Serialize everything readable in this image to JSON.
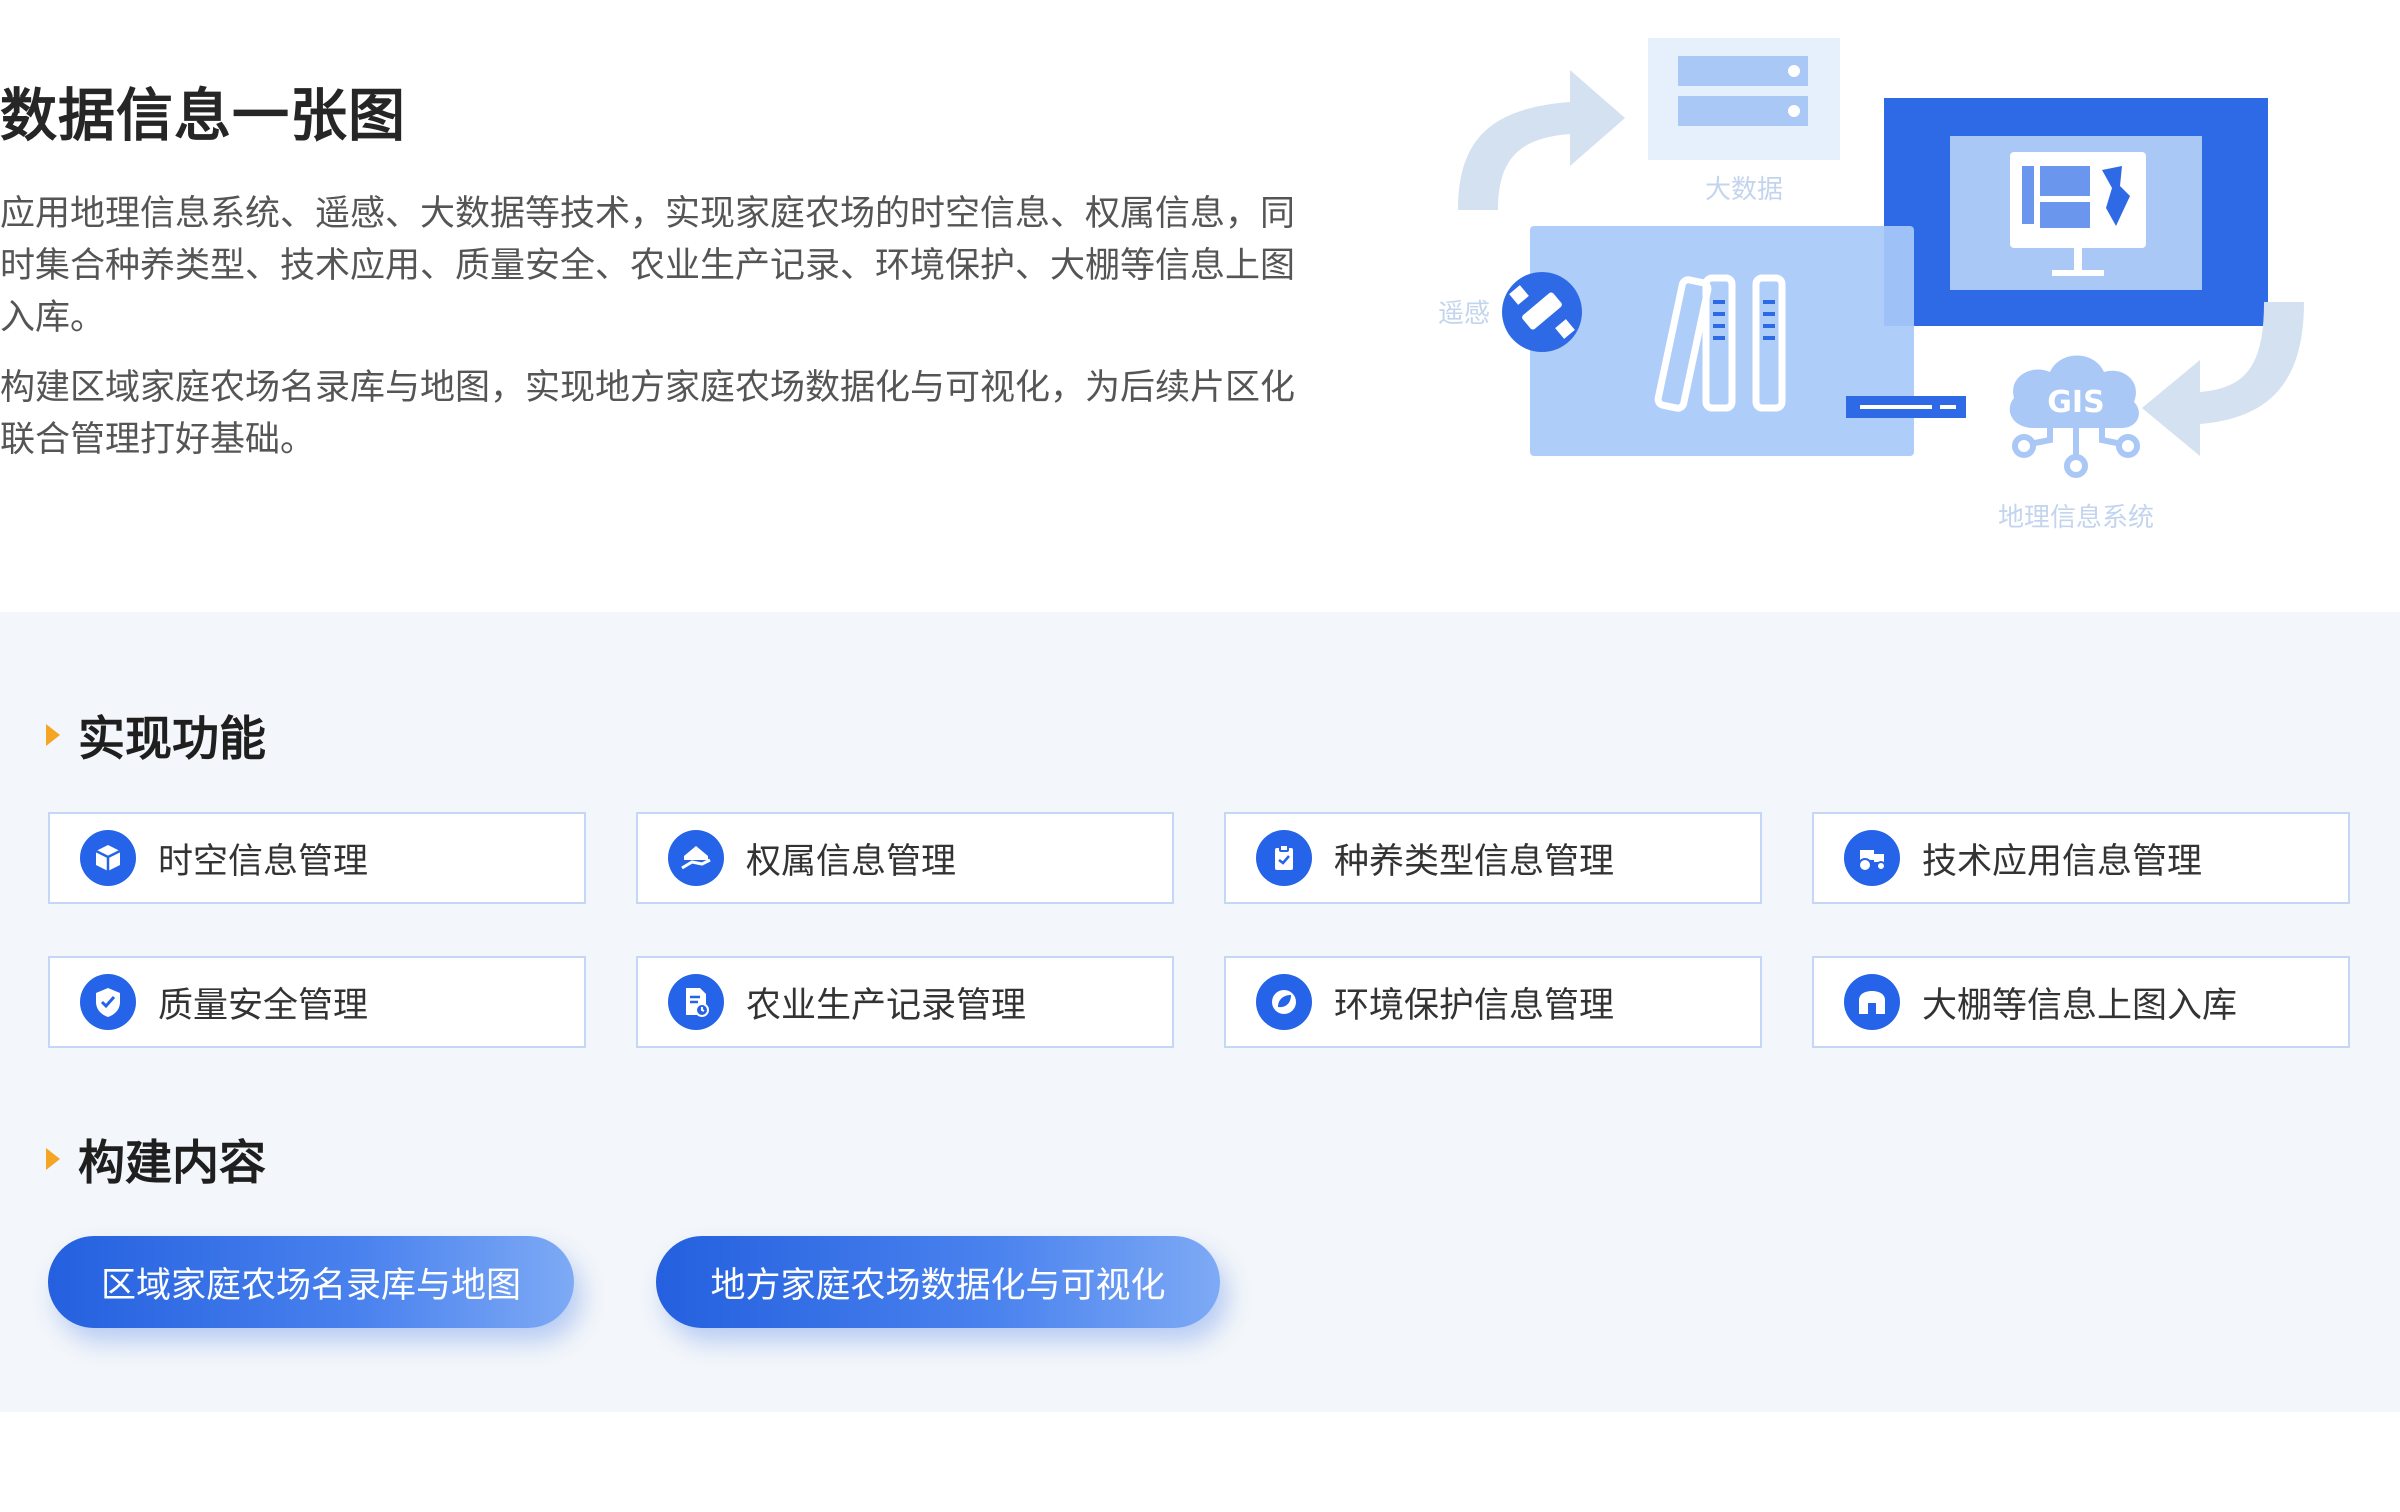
{
  "hero": {
    "title": "数据信息一张图",
    "paragraphs": [
      "应用地理信息系统、遥感、大数据等技术，实现家庭农场的时空信息、权属信息，同时集合种养类型、技术应用、质量安全、农业生产记录、环境保护、大棚等信息上图入库。",
      "构建区域家庭农场名录库与地图，实现地方家庭农场数据化与可视化，为后续片区化联合管理打好基础。"
    ]
  },
  "illustration": {
    "big_data_label": "大数据",
    "remote_sensing_label": "遥感",
    "gis_badge": "GIS",
    "gis_label": "地理信息系统"
  },
  "functions": {
    "heading": "实现功能",
    "items": [
      {
        "label": "时空信息管理",
        "icon": "cube-icon"
      },
      {
        "label": "权属信息管理",
        "icon": "house-hand-icon"
      },
      {
        "label": "种养类型信息管理",
        "icon": "clipboard-icon"
      },
      {
        "label": "技术应用信息管理",
        "icon": "tractor-icon"
      },
      {
        "label": "质量安全管理",
        "icon": "shield-check-icon"
      },
      {
        "label": "农业生产记录管理",
        "icon": "document-clock-icon"
      },
      {
        "label": "环境保护信息管理",
        "icon": "leaf-icon"
      },
      {
        "label": "大棚等信息上图入库",
        "icon": "greenhouse-icon"
      }
    ]
  },
  "build": {
    "heading": "构建内容",
    "buttons": [
      "区域家庭农场名录库与地图",
      "地方家庭农场数据化与可视化"
    ]
  },
  "colors": {
    "accent": "#2563e8",
    "triangle": "#f5a524",
    "section_bg": "#f3f6fa",
    "card_border": "#c5d7f6"
  }
}
